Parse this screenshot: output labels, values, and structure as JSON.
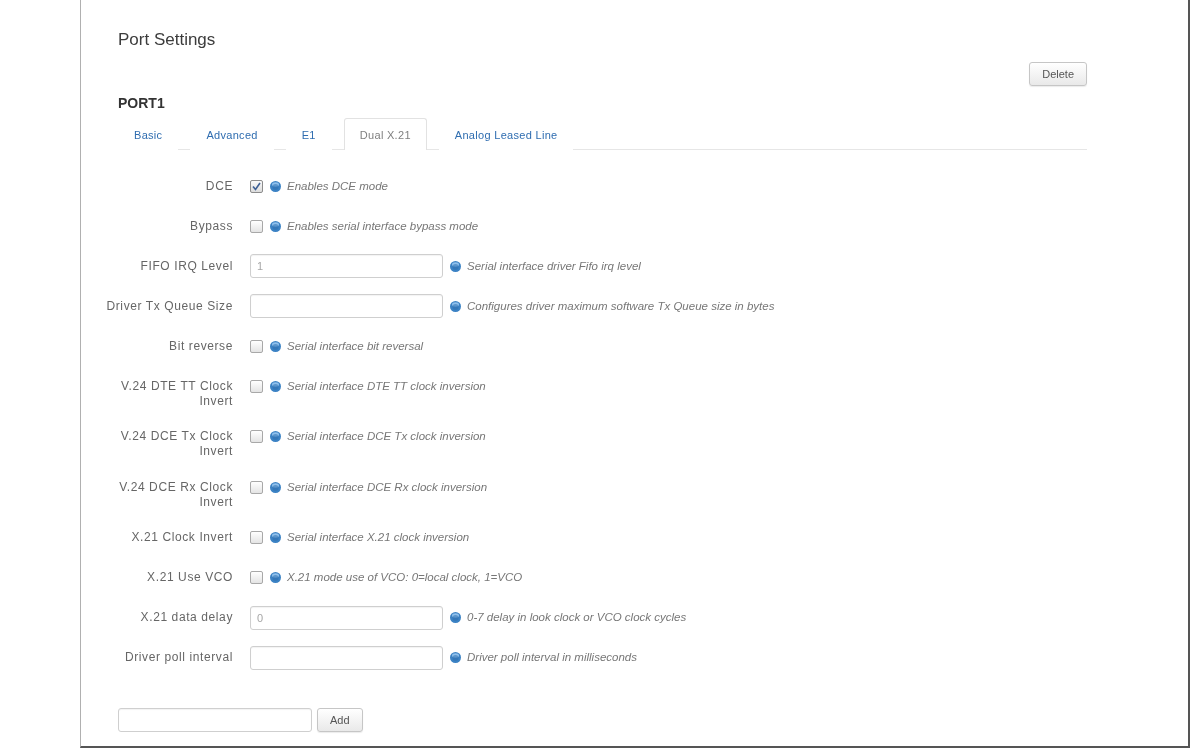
{
  "page_title": "Port Settings",
  "delete_button": {
    "label": "Delete"
  },
  "section": {
    "title": "PORT1",
    "tabs": [
      {
        "label": "Basic",
        "selected": false
      },
      {
        "label": "Advanced",
        "selected": false
      },
      {
        "label": "E1",
        "selected": false
      },
      {
        "label": "Dual X.21",
        "selected": true
      },
      {
        "label": "Analog Leased Line",
        "selected": false
      }
    ],
    "fields": [
      {
        "kind": "checkbox",
        "label": "DCE",
        "checked": true,
        "hint": "Enables DCE mode"
      },
      {
        "kind": "checkbox",
        "label": "Bypass",
        "checked": false,
        "hint": "Enables serial interface bypass mode"
      },
      {
        "kind": "text",
        "label": "FIFO IRQ Level",
        "placeholder": "1",
        "hint": "Serial interface driver Fifo irq level"
      },
      {
        "kind": "text",
        "label": "Driver Tx Queue Size",
        "hint": "Configures driver maximum software Tx Queue size in bytes"
      },
      {
        "kind": "checkbox",
        "label": "Bit reverse",
        "checked": false,
        "hint": "Serial interface bit reversal"
      },
      {
        "kind": "checkbox",
        "label": "V.24 DTE TT Clock Invert",
        "checked": false,
        "hint": "Serial interface DTE TT clock inversion"
      },
      {
        "kind": "checkbox",
        "label": "V.24 DCE Tx Clock Invert",
        "checked": false,
        "hint": "Serial interface DCE Tx clock inversion"
      },
      {
        "kind": "checkbox",
        "label": "V.24 DCE Rx Clock Invert",
        "checked": false,
        "hint": "Serial interface DCE Rx clock inversion"
      },
      {
        "kind": "checkbox",
        "label": "X.21 Clock Invert",
        "checked": false,
        "hint": "Serial interface X.21 clock inversion"
      },
      {
        "kind": "checkbox",
        "label": "X.21 Use VCO",
        "checked": false,
        "hint": "X.21 mode use of VCO: 0=local clock, 1=VCO"
      },
      {
        "kind": "text",
        "label": "X.21 data delay",
        "placeholder": "0",
        "hint": "0-7 delay in look clock or VCO clock cycles"
      },
      {
        "kind": "text",
        "label": "Driver poll interval",
        "hint": "Driver poll interval in milliseconds"
      }
    ]
  },
  "add_button": {
    "label": "Add"
  }
}
